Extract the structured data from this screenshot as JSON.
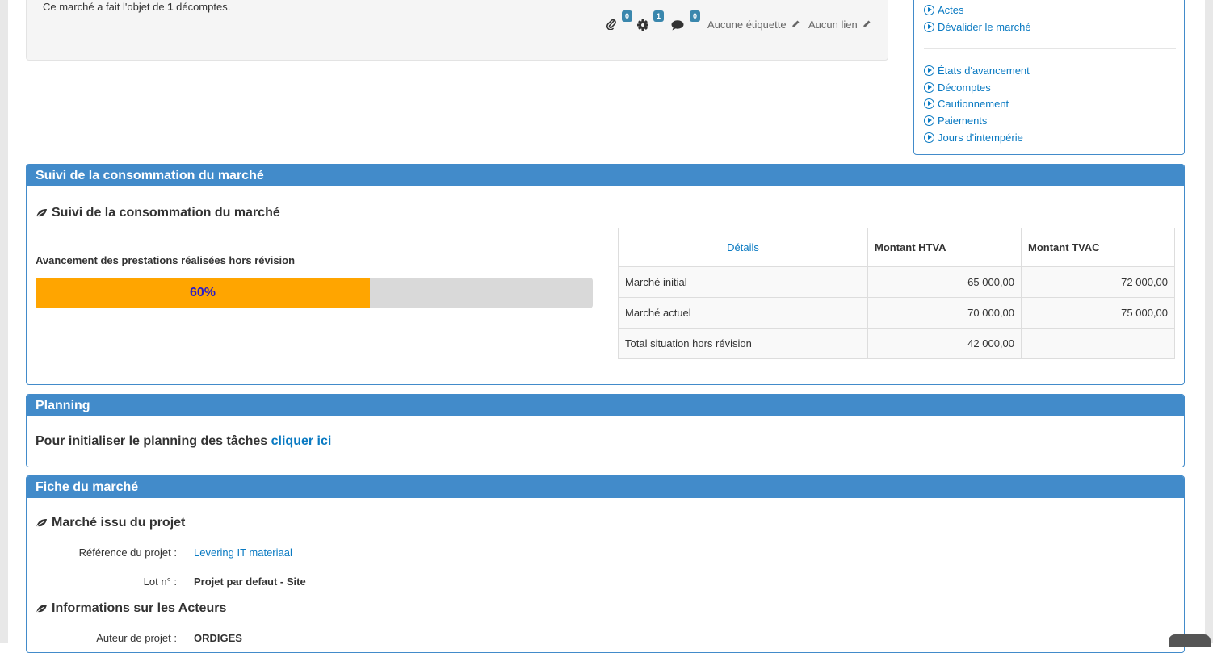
{
  "top_well": {
    "count_prefix": "Ce marché a fait l'objet de",
    "count_value": "1",
    "count_suffix": "décomptes.",
    "attachments_badge": "0",
    "settings_badge": "1",
    "comments_badge": "0",
    "tags_label": "Aucune étiquette",
    "links_label": "Aucun lien"
  },
  "sidenav": {
    "actes": "Actes",
    "devalider": "Dévalider le marché",
    "etats": "États d'avancement",
    "decomptes": "Décomptes",
    "cautionnement": "Cautionnement",
    "paiements": "Paiements",
    "intemperie": "Jours d'intempérie"
  },
  "consumption": {
    "panel_title": "Suivi de la consommation du marché",
    "heading": "Suivi de la consommation du marché",
    "progress_label": "Avancement des prestations réalisées hors révision",
    "progress_fraction": 0.6,
    "progress_text": "60%",
    "table": {
      "details": "Détails",
      "col_htva": "Montant HTVA",
      "col_tvac": "Montant TVAC",
      "rows": [
        {
          "label": "Marché initial",
          "htva": "65 000,00",
          "tvac": "72 000,00"
        },
        {
          "label": "Marché actuel",
          "htva": "70 000,00",
          "tvac": "75 000,00"
        },
        {
          "label": "Total situation hors révision",
          "htva": "42 000,00",
          "tvac": ""
        }
      ]
    }
  },
  "planning": {
    "panel_title": "Planning",
    "text": "Pour initialiser le planning des tâches",
    "link": "cliquer ici"
  },
  "fiche": {
    "panel_title": "Fiche du marché",
    "heading_project": "Marché issu du projet",
    "ref_label": "Référence du projet :",
    "ref_value": "Levering IT materiaal",
    "lot_label": "Lot n° :",
    "lot_value": "Projet par defaut - Site",
    "heading_actors": "Informations sur les Acteurs",
    "author_label": "Auteur de projet :",
    "author_value": "ORDIGES"
  }
}
